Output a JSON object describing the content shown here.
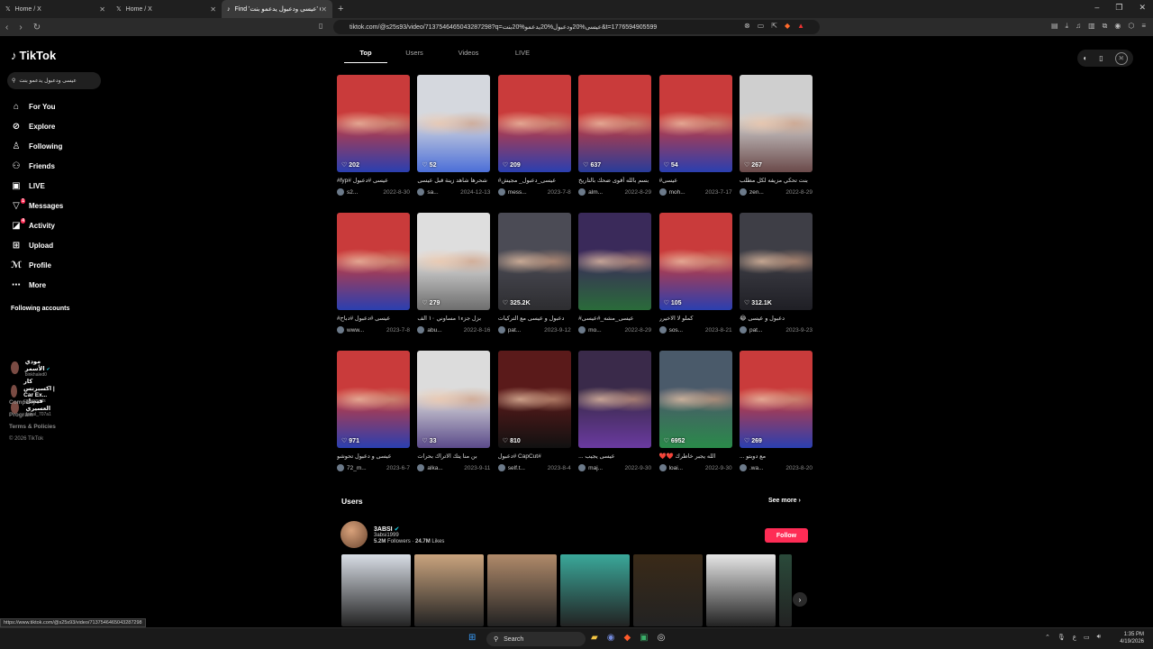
{
  "browser": {
    "tabs": [
      {
        "label": "Home / X",
        "icon": "x-logo-icon"
      },
      {
        "label": "Home / X",
        "icon": "x-logo-icon"
      },
      {
        "label": "Find 'عيسى ودعبول يدعمو بنت' on TikTok",
        "icon": "tiktok-icon"
      }
    ],
    "url": "tiktok.com/@s25s93/video/7137546465043287298?q=عيسى%20ودعبول%20يدعمو%20بنت&t=1776594905599",
    "status_url": "https://www.tiktok.com/@s25s93/video/7137546465043287298"
  },
  "sidebar": {
    "logo": "TikTok",
    "search_value": "عيسى ودعبول يدعمو بنت",
    "menu": [
      {
        "label": "For You",
        "icon": "home-icon",
        "glyph": "⌂"
      },
      {
        "label": "Explore",
        "icon": "compass-icon",
        "glyph": "⊘"
      },
      {
        "label": "Following",
        "icon": "user-check-icon",
        "glyph": "♙"
      },
      {
        "label": "Friends",
        "icon": "friends-icon",
        "glyph": "⚇"
      },
      {
        "label": "LIVE",
        "icon": "live-icon",
        "glyph": "▣"
      },
      {
        "label": "Messages",
        "icon": "messages-icon",
        "glyph": "▽",
        "badge": "1"
      },
      {
        "label": "Activity",
        "icon": "activity-icon",
        "glyph": "◪",
        "badge": "4"
      },
      {
        "label": "Upload",
        "icon": "upload-icon",
        "glyph": "⊞"
      },
      {
        "label": "Profile",
        "icon": "profile-icon",
        "glyph": "ℳ"
      },
      {
        "label": "More",
        "icon": "more-icon",
        "glyph": "⋯"
      }
    ],
    "following_title": "Following accounts",
    "following": [
      {
        "name": "مودي الأسمر",
        "handle": "binkhaled0",
        "verified": true
      },
      {
        "name": "كار اكسبرتس | Car Ex...",
        "handle": "car.experts",
        "verified": false
      },
      {
        "name": "فيصل العسيري",
        "handle": "faisal_707a1",
        "verified": false
      }
    ],
    "footer": [
      "Company",
      "Program",
      "Terms & Policies"
    ],
    "copyright": "© 2026 TikTok"
  },
  "search_tabs": [
    "Top",
    "Users",
    "Videos",
    "LIVE"
  ],
  "videos": [
    {
      "likes": "202",
      "caption": "عيسى #دعبول #fyp#",
      "user": "s2...",
      "date": "2022-8-30",
      "c1": "#c93b3b",
      "c2": "#2a3fb0"
    },
    {
      "likes": "52",
      "caption": "شحرها شاهد زينة قبل عيسى",
      "user": "sa...",
      "date": "2024-12-13",
      "c1": "#d5d8de",
      "c2": "#4c6fd8"
    },
    {
      "likes": "209",
      "caption": "عيسى_دعبول_ مجيش#",
      "user": "mess...",
      "date": "2023-7-8",
      "c1": "#c93b3b",
      "c2": "#2a3fb0"
    },
    {
      "likes": "637",
      "caption": "بسم بالله أقوى ضحك بالتاريخ",
      "user": "alm...",
      "date": "2022-8-29",
      "c1": "#c93b3b",
      "c2": "#283c9a"
    },
    {
      "likes": "54",
      "caption": "عيسى#",
      "user": "moh...",
      "date": "2023-7-17",
      "c1": "#c93b3b",
      "c2": "#2a3fb0"
    },
    {
      "likes": "267",
      "caption": "بنت تحكي مزيفه لكل مطلب",
      "user": "zen...",
      "date": "2022-8-29",
      "c1": "#cfcfcf",
      "c2": "#6b4a4a"
    },
    {
      "likes": "",
      "caption": "عيسى #دعبول #دباح#",
      "user": "www...",
      "date": "2023-7-8",
      "c1": "#c93b3b",
      "c2": "#2a3fb0"
    },
    {
      "likes": "279",
      "caption": "بزل جزء١ مساوني ١٠ الف",
      "user": "abu...",
      "date": "2022-8-16",
      "c1": "#dedede",
      "c2": "#6d6d6d"
    },
    {
      "likes": "325.2K",
      "caption": "دعبول و عيسى مع التركيات",
      "user": "pat...",
      "date": "2023-9-12",
      "c1": "#4b4b55",
      "c2": "#2d2d30"
    },
    {
      "likes": "",
      "caption": "عيسى_مشه_#عيسى#",
      "user": "mo...",
      "date": "2022-8-29",
      "c1": "#3a2a5a",
      "c2": "#2a6b3a"
    },
    {
      "likes": "105",
      "caption": "كملو لا الاخيرر",
      "user": "sos...",
      "date": "2023-8-21",
      "c1": "#c93b3b",
      "c2": "#2a3fb0"
    },
    {
      "likes": "312.1K",
      "caption": "دعبول و عيسى 😂",
      "user": "pat...",
      "date": "2023-9-23",
      "c1": "#3e3e46",
      "c2": "#1f1f25"
    },
    {
      "likes": "971",
      "caption": "عيسى و دعبول تحوشو",
      "user": "72_m...",
      "date": "2023-6-7",
      "c1": "#c93b3b",
      "c2": "#2a3fb0"
    },
    {
      "likes": "33",
      "caption": "بن منا يتك الاتراك بحرات",
      "user": "alka...",
      "date": "2023-9-11",
      "c1": "#dcdcdc",
      "c2": "#5a4a8a"
    },
    {
      "likes": "810",
      "caption": "#CapCut #دعبول",
      "user": "self.t...",
      "date": "2023-8-4",
      "c1": "#5a1a1a",
      "c2": "#111"
    },
    {
      "likes": "",
      "caption": "عيسى يجيب ...",
      "user": "maj...",
      "date": "2022-9-30",
      "c1": "#3a2a4a",
      "c2": "#6a3aa0"
    },
    {
      "likes": "6952",
      "caption": "الله يجبر خاطرك ❤️❤️",
      "user": "loai...",
      "date": "2022-9-30",
      "c1": "#4a5a6a",
      "c2": "#2a8a4a"
    },
    {
      "likes": "269",
      "caption": "مع دوبتو ...",
      "user": ".wa...",
      "date": "2023-8-20",
      "c1": "#c93b3b",
      "c2": "#2a3fb0"
    }
  ],
  "users_section": {
    "title": "Users",
    "see_more": "See more",
    "user": {
      "name": "3ABSI",
      "handle": "3absi1999",
      "followers": "5.2M",
      "likes": "24.7M",
      "followers_label": "Followers",
      "likes_label": "Likes",
      "verified": true
    },
    "follow_label": "Follow",
    "thumb_colors": [
      "#d8dde5",
      "#caa47e",
      "#b08a6a",
      "#3aa89a",
      "#3a2a18",
      "#e6e6e6",
      "#2a4a3a"
    ]
  },
  "taskbar": {
    "search": "Search",
    "time": "1:35 PM",
    "date": "4/19/2026"
  }
}
